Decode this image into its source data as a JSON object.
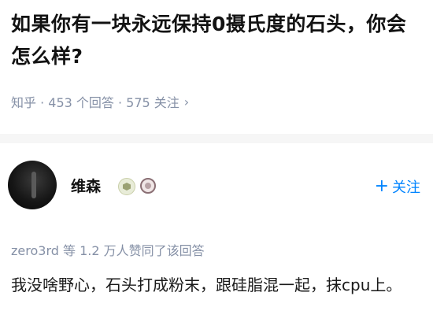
{
  "question": {
    "title": "如果你有一块永远保持0摄氏度的石头，你会怎么样?"
  },
  "meta": {
    "text": "知乎 · 453 个回答 · 575 关注",
    "chevron_icon": "chevron-right-icon"
  },
  "author": {
    "name": "维森",
    "avatar_icon": "avatar",
    "badges": [
      "hexagon-badge-icon",
      "ring-badge-icon"
    ],
    "follow_label": "关注",
    "follow_icon": "plus-icon"
  },
  "endorsement": {
    "text": "zero3rd 等 1.2 万人赞同了该回答"
  },
  "answer": {
    "body": "我没啥野心，石头打成粉末，跟硅脂混一起，抹cpu上。"
  },
  "colors": {
    "accent": "#0084ff",
    "muted": "#8590a6",
    "text": "#121212"
  }
}
